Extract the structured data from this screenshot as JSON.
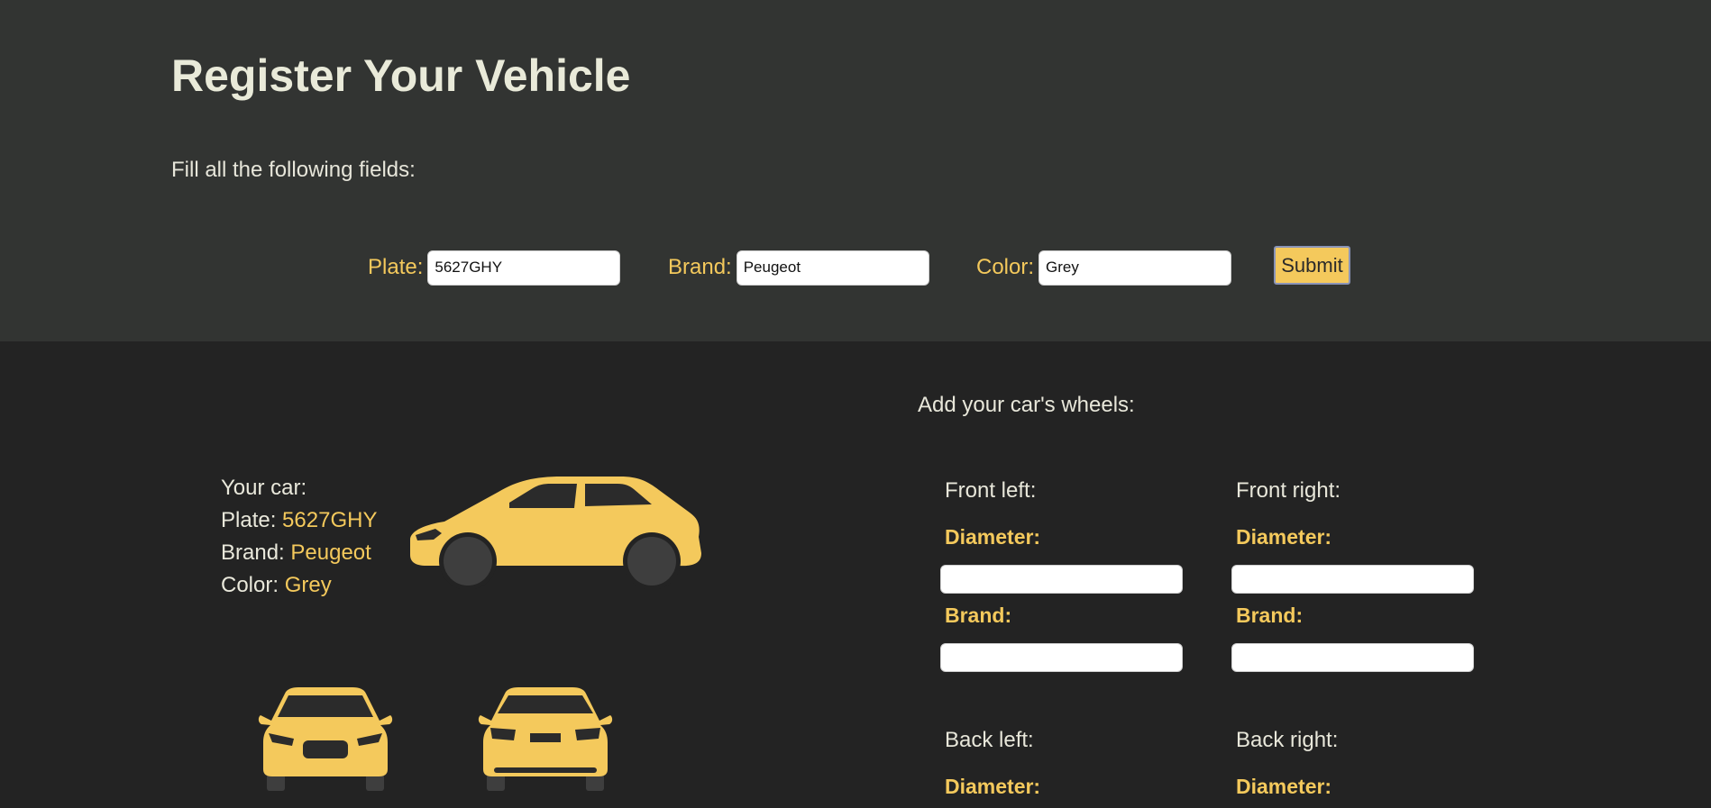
{
  "header": {
    "title": "Register Your Vehicle",
    "subtitle": "Fill all the following fields:"
  },
  "form": {
    "plate_label": "Plate:",
    "plate_value": "5627GHY",
    "brand_label": "Brand:",
    "brand_value": "Peugeot",
    "color_label": "Color:",
    "color_value": "Grey",
    "submit_label": "Submit"
  },
  "car_info": {
    "heading": "Your car:",
    "plate_label": "Plate: ",
    "plate_value": "5627GHY",
    "brand_label": "Brand: ",
    "brand_value": "Peugeot",
    "color_label": "Color: ",
    "color_value": "Grey"
  },
  "icons": {
    "side": "car-side-icon",
    "front": "car-front-icon",
    "back": "car-back-icon"
  },
  "wheels": {
    "title": "Add your car's wheels:",
    "front_left": {
      "label": "Front left:",
      "diameter_label": "Diameter:",
      "diameter_value": "",
      "brand_label": "Brand:",
      "brand_value": ""
    },
    "front_right": {
      "label": "Front right:",
      "diameter_label": "Diameter:",
      "diameter_value": "",
      "brand_label": "Brand:",
      "brand_value": ""
    },
    "back_left": {
      "label": "Back left:",
      "diameter_label": "Diameter:"
    },
    "back_right": {
      "label": "Back right:",
      "diameter_label": "Diameter:"
    }
  },
  "colors": {
    "accent": "#f4c95c",
    "header_bg": "#323432",
    "body_bg": "#232323",
    "text": "#e9e8db"
  }
}
